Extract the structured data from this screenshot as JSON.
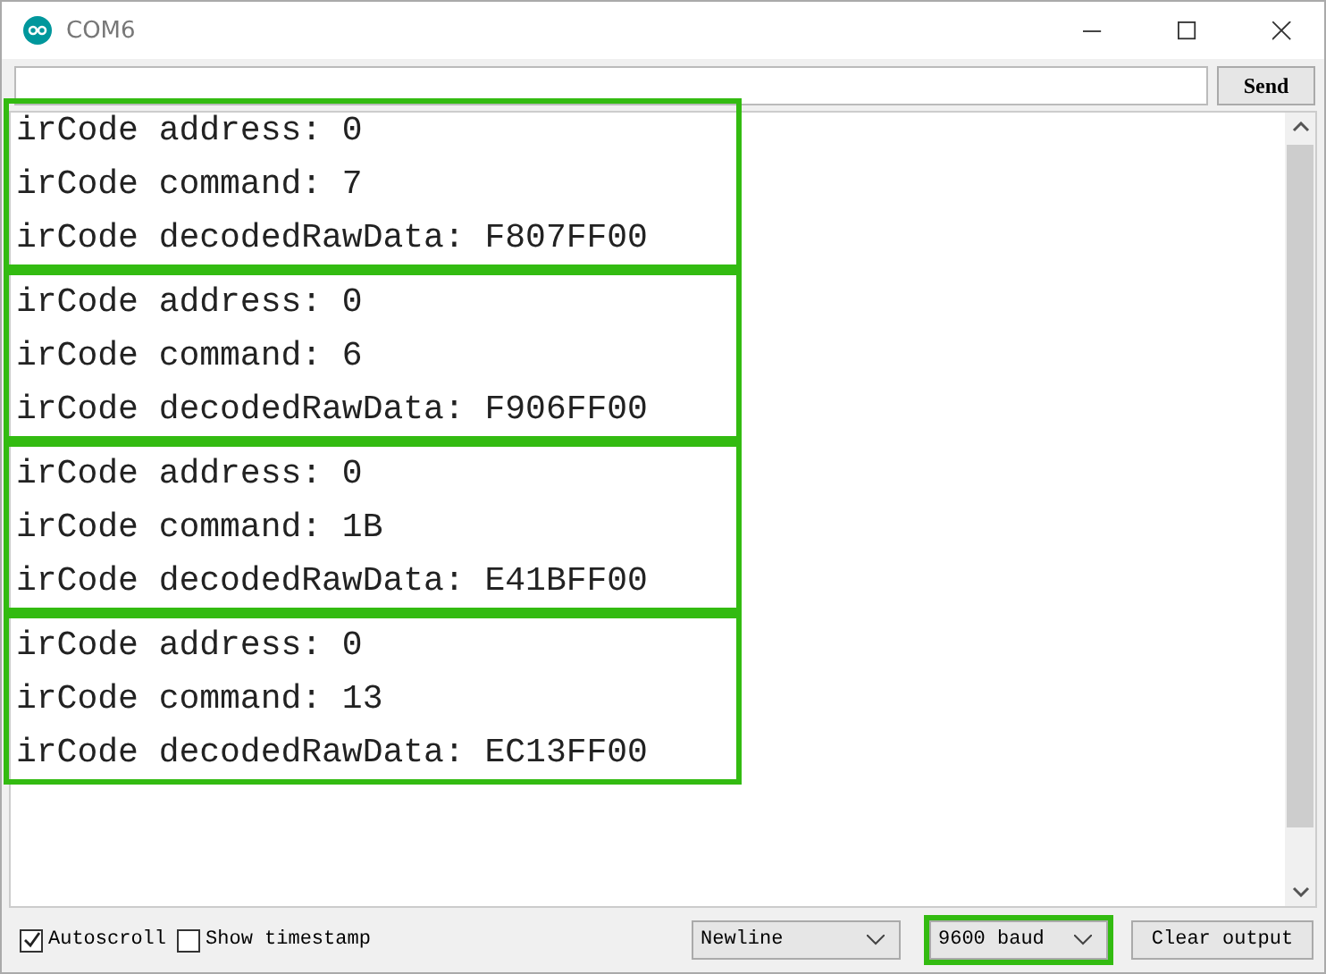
{
  "window": {
    "title": "COM6"
  },
  "send_button": "Send",
  "output_groups": [
    {
      "highlighted": true,
      "lines": [
        "irCode address: 0",
        "irCode command: 7",
        "irCode decodedRawData: F807FF00"
      ]
    },
    {
      "highlighted": true,
      "lines": [
        "irCode address: 0",
        "irCode command: 6",
        "irCode decodedRawData: F906FF00"
      ]
    },
    {
      "highlighted": true,
      "lines": [
        "irCode address: 0",
        "irCode command: 1B",
        "irCode decodedRawData: E41BFF00"
      ]
    },
    {
      "highlighted": true,
      "lines": [
        "irCode address: 0",
        "irCode command: 13",
        "irCode decodedRawData: EC13FF00"
      ]
    }
  ],
  "options": [
    {
      "label": "Autoscroll",
      "checked": true
    },
    {
      "label": "Show timestamp",
      "checked": false
    }
  ],
  "line_ending": {
    "value": "Newline",
    "highlighted": false
  },
  "baud": {
    "value": "9600 baud",
    "highlighted": true
  },
  "clear_button": "Clear output"
}
